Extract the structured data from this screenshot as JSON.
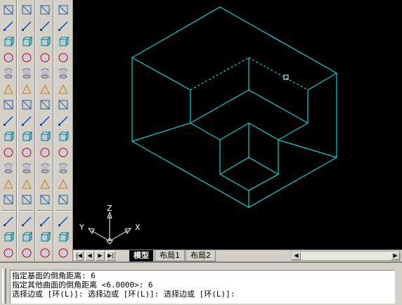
{
  "toolbars": {
    "left1": [
      "line-icon",
      "ray-icon",
      "construction-line-icon",
      "polyline-icon",
      "polygon-icon",
      "rectangle-icon",
      "arc-icon",
      "circle-icon",
      "spline-icon",
      "ellipse-icon",
      "insert-block-icon",
      "make-block-icon",
      "point-icon",
      "hatch-icon",
      "region-icon",
      "table-icon",
      "text-icon"
    ],
    "left2": [
      "box-icon",
      "wedge-icon",
      "cone-icon",
      "sphere-icon",
      "cylinder-icon",
      "torus-icon",
      "pyramid-icon",
      "extrude-icon",
      "revolve-icon",
      "slice-icon",
      "section-icon",
      "interfere-icon",
      "setup-drawing-icon",
      "setup-view-icon",
      "setup-profile-icon",
      "box-mesh-icon"
    ],
    "left3": [
      "union-icon",
      "subtract-icon",
      "intersect-icon",
      "extrude-faces-icon",
      "move-faces-icon",
      "offset-faces-icon",
      "delete-faces-icon",
      "rotate-faces-icon",
      "taper-faces-icon",
      "copy-faces-icon",
      "color-faces-icon",
      "imprint-icon",
      "clean-icon",
      "separate-icon",
      "shell-icon",
      "check-icon"
    ],
    "left4": [
      "sphere-shade-icon",
      "cylinder-shade-icon",
      "cone-shade-icon",
      "torus-shade-icon",
      "dish-icon",
      "dome-icon",
      "mesh-icon",
      "3d-face-icon",
      "edge-icon",
      "3d-mesh-icon",
      "revolved-surface-icon",
      "tabulated-surface-icon",
      "ruled-surface-icon",
      "edge-surface-icon",
      "render-icon",
      "material-icon"
    ]
  },
  "viewport": {
    "background": "#000000",
    "line_color": "#00ffff",
    "ucs": {
      "x_label": "X",
      "y_label": "Y",
      "z_label": "Z"
    }
  },
  "tabs": {
    "model": "模型",
    "layout1": "布局1",
    "layout2": "布局2"
  },
  "command": {
    "lines": [
      "指定基面的倒角距离: 6",
      "指定其他曲面的倒角距离 <6.0000>: 6",
      "选择边或 [环(L)]: 选择边或 [环(L)]: 选择边或 [环(L)]:"
    ]
  }
}
